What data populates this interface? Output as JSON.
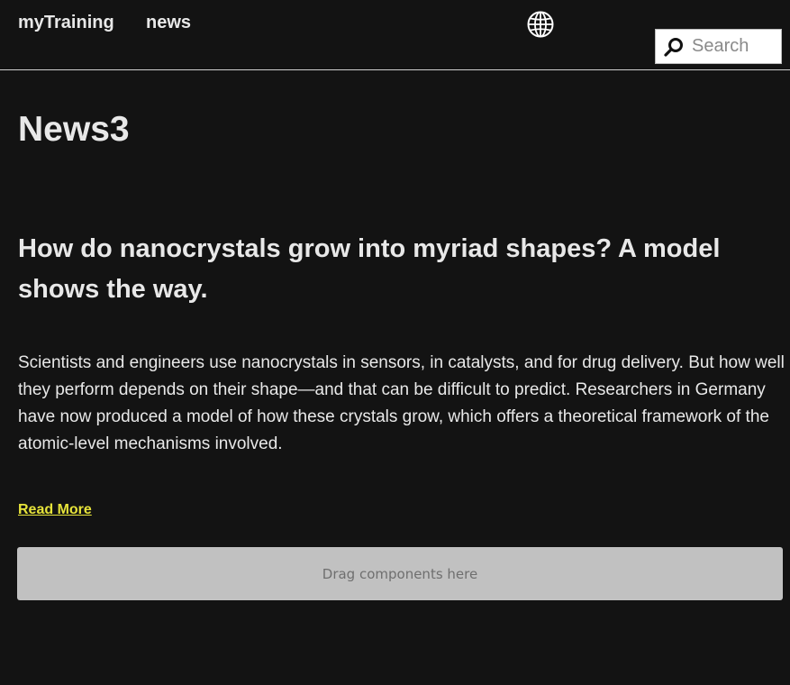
{
  "header": {
    "nav": [
      {
        "label": "myTraining"
      },
      {
        "label": "news"
      }
    ],
    "language_icon": "globe-icon",
    "search": {
      "icon": "search-icon",
      "placeholder": "Search",
      "value": ""
    }
  },
  "main": {
    "page_title": "News3",
    "article": {
      "title": "How do nanocrystals grow into myriad shapes? A model shows the way.",
      "body": "Scientists and engineers use nanocrystals in sensors, in catalysts, and for drug delivery. But how well they perform depends on their shape—and that can be difficult to predict. Researchers in Germany have now produced a model of how these crystals grow, which offers a theoretical framework of the atomic-level mechanisms involved.",
      "read_more_label": "Read More"
    },
    "drop_zone_label": "Drag components here"
  },
  "colors": {
    "background": "#131313",
    "text": "#e8e8e8",
    "link_accent": "#e6e33a",
    "drop_zone": "#c1c1c1"
  }
}
